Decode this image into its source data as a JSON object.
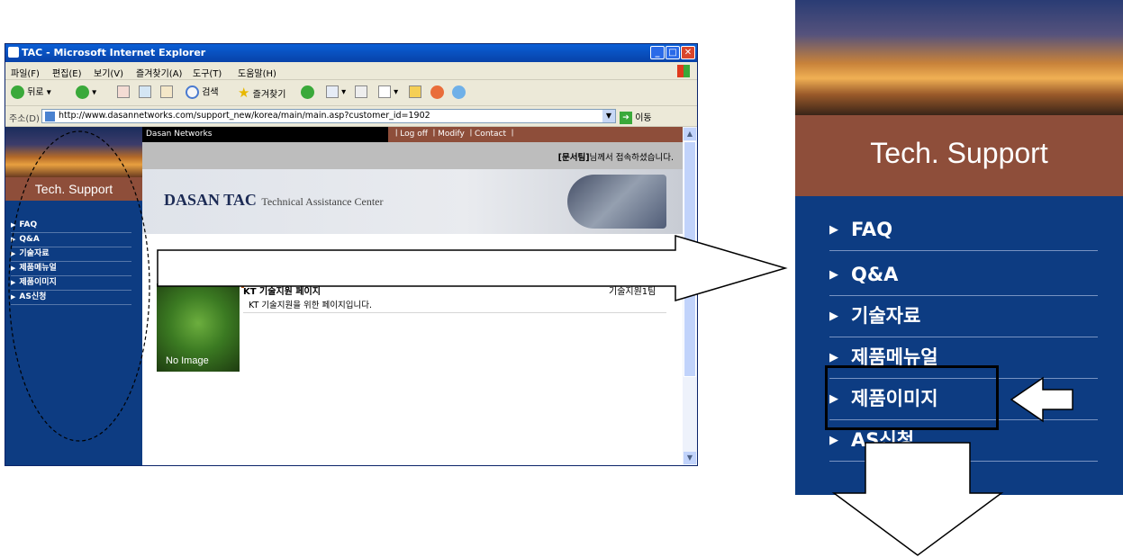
{
  "window": {
    "title": "TAC - Microsoft Internet Explorer",
    "controls": {
      "minimize": "_",
      "maximize": "□",
      "close": "✕"
    }
  },
  "menubar": [
    "파일(F)",
    "편집(E)",
    "보기(V)",
    "즐겨찾기(A)",
    "도구(T)",
    "도움말(H)"
  ],
  "toolbar": {
    "back": "뒤로",
    "search": "검색",
    "favorites": "즐겨찾기"
  },
  "address": {
    "label": "주소(D)",
    "url": "http://www.dasannetworks.com/support_new/korea/main/main.asp?customer_id=1902",
    "go": "이동"
  },
  "page": {
    "company": "Dasan Networks",
    "links": "ㅣLog off ㅣModify ㅣContact ㅣ",
    "greeting_name": "[문서팀]",
    "greeting_rest": "님께서 접속하셨습니다.",
    "banner_title": "DASAN TAC",
    "banner_subtitle": "Technical Assistance Center",
    "item": {
      "title": "KT 기술지원 페이지",
      "team": "기술지원1팀",
      "description": "KT 기술지원을 위한 페이지입니다.",
      "image_text": "No Image"
    }
  },
  "nav": {
    "header": "Tech. Support",
    "items": [
      "FAQ",
      "Q&A",
      "기술자료",
      "제품메뉴얼",
      "제품이미지",
      "AS신청"
    ]
  },
  "zoom": {
    "header": "Tech. Support",
    "items": [
      "FAQ",
      "Q&A",
      "기술자료",
      "제품메뉴얼",
      "제품이미지",
      "AS신청"
    ],
    "highlighted": "제품이미지"
  },
  "colors": {
    "nav_bg": "#0d3c82",
    "header_brown": "#8e4e3a",
    "titlebar_blue": "#0a5fd6"
  }
}
